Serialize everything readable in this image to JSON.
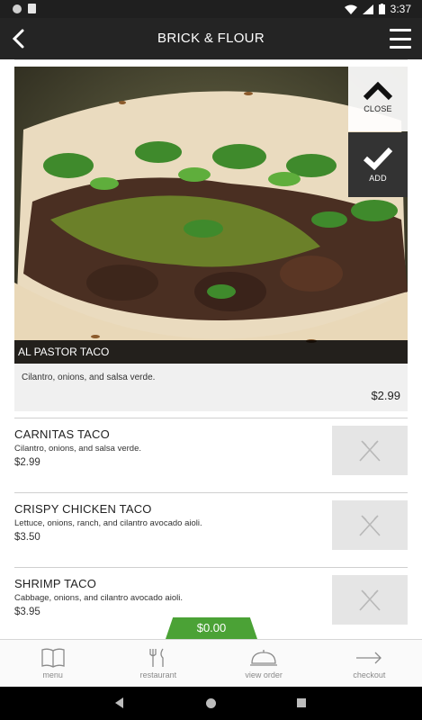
{
  "status_bar": {
    "time": "3:37"
  },
  "header": {
    "title": "BRICK & FLOUR"
  },
  "featured": {
    "name": "AL PASTOR TACO",
    "description": "Cilantro, onions, and salsa verde.",
    "price": "$2.99",
    "close_label": "CLOSE",
    "add_label": "ADD"
  },
  "menu_items": [
    {
      "name": "CARNITAS TACO",
      "description": "Cilantro, onions, and salsa verde.",
      "price": "$2.99"
    },
    {
      "name": "CRISPY CHICKEN TACO",
      "description": "Lettuce, onions, ranch, and cilantro avocado aioli.",
      "price": "$3.50"
    },
    {
      "name": "SHRIMP TACO",
      "description": "Cabbage, onions, and cilantro avocado aioli.",
      "price": "$3.95"
    }
  ],
  "order_total": "$0.00",
  "bottom_nav": [
    {
      "label": "menu",
      "icon": "book-icon"
    },
    {
      "label": "restaurant",
      "icon": "fork-knife-icon"
    },
    {
      "label": "view order",
      "icon": "cloche-icon"
    },
    {
      "label": "checkout",
      "icon": "arrow-right-icon"
    }
  ],
  "colors": {
    "accent_green": "#4ba236",
    "header_dark": "#242424"
  }
}
